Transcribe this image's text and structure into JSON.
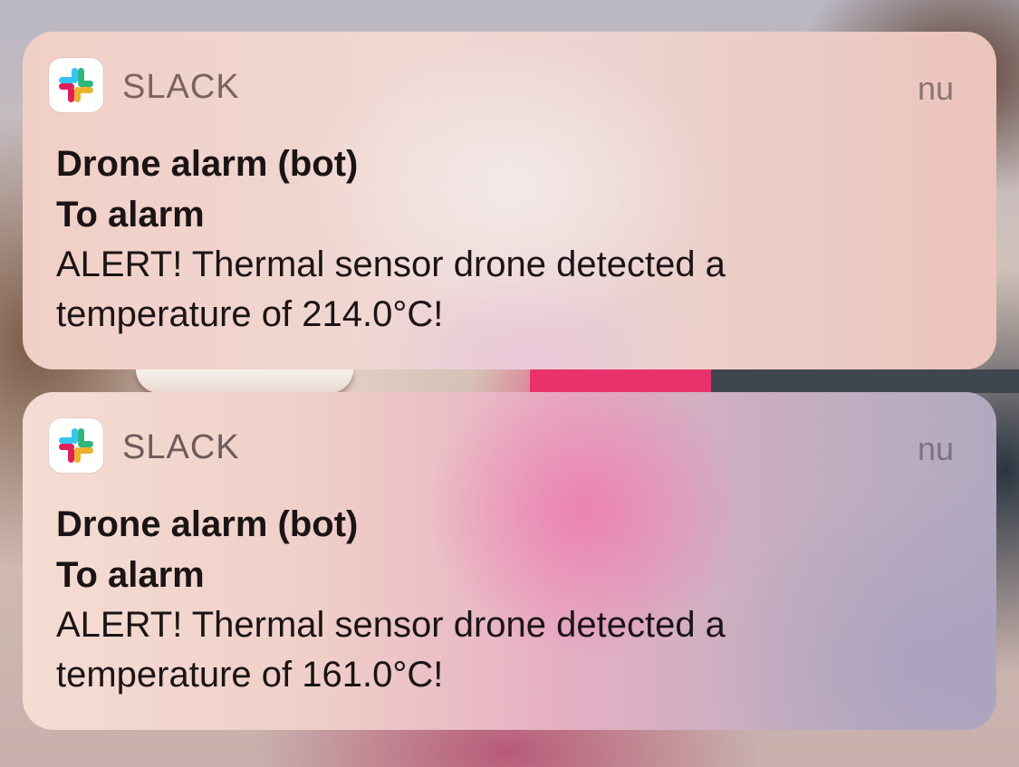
{
  "notifications": [
    {
      "app_name": "SLACK",
      "time": "nu",
      "app_icon": "slack-logo-icon",
      "sender": "Drone alarm (bot)",
      "channel": "To alarm",
      "message": "ALERT! Thermal sensor drone detected a temperature of 214.0°C!"
    },
    {
      "app_name": "SLACK",
      "time": "nu",
      "app_icon": "slack-logo-icon",
      "sender": "Drone alarm (bot)",
      "channel": "To alarm",
      "message": "ALERT! Thermal sensor drone detected a temperature of 161.0°C!"
    }
  ],
  "colors": {
    "slack_blue": "#36C5F0",
    "slack_green": "#2EB67D",
    "slack_yellow": "#ECB22E",
    "slack_red": "#E01E5A"
  }
}
